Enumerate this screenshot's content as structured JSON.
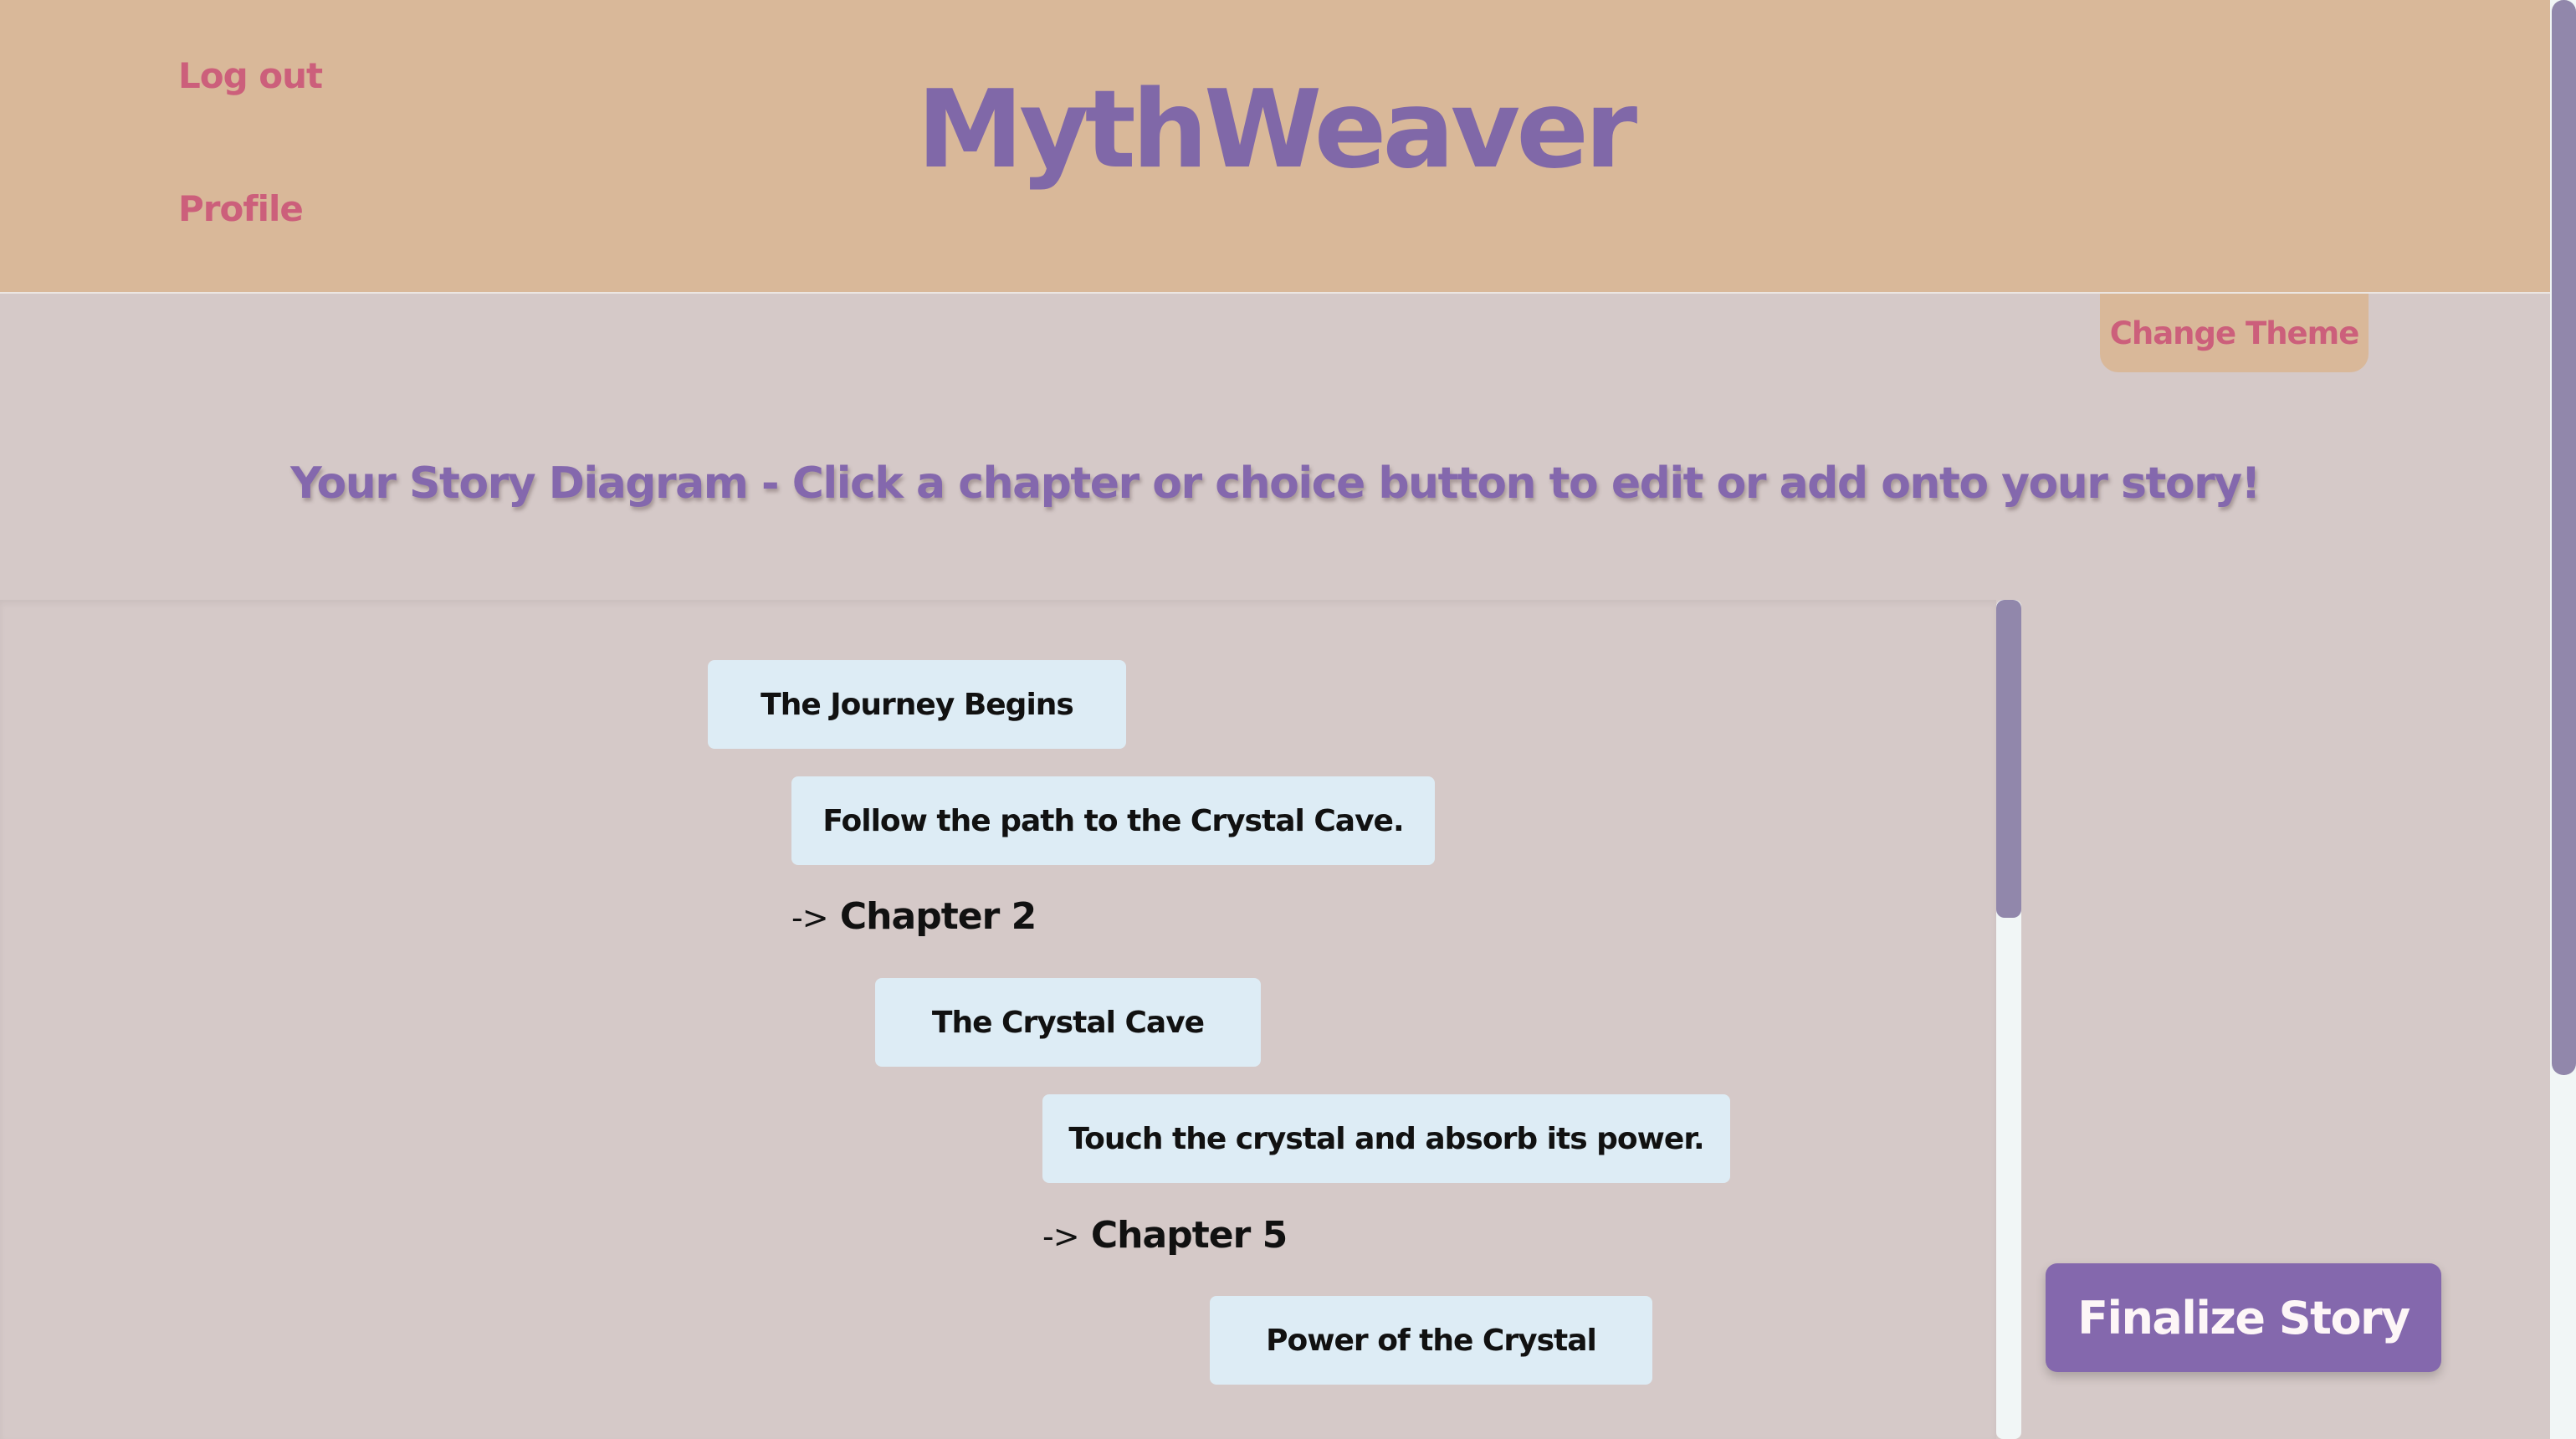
{
  "header": {
    "brand": "MythWeaver",
    "logout_label": "Log out",
    "profile_label": "Profile",
    "colors": {
      "header_bg": "#d9b899",
      "brand": "#8068a8",
      "link": "#cc5f7b"
    }
  },
  "theme": {
    "label": "Change Theme"
  },
  "diagram": {
    "heading": "Your Story Diagram  -  Click a chapter or choice button to edit or add onto your story!",
    "chapter1_title": "The Journey Begins",
    "choice1_text": "Follow the path to the Crystal Cave.",
    "link1_arrow": "->",
    "link1_target": "Chapter 2",
    "chapter2_title": "The Crystal Cave",
    "choice2_text": "Touch the crystal and absorb its power.",
    "link2_arrow": "->",
    "link2_target": "Chapter 5",
    "chapter5_title": "Power of the Crystal",
    "colors": {
      "node_bg": "#ddecf5",
      "page_bg": "#d5c9c8"
    }
  },
  "actions": {
    "finalize_label": "Finalize Story",
    "colors": {
      "finalize_bg": "#8468ad"
    }
  }
}
